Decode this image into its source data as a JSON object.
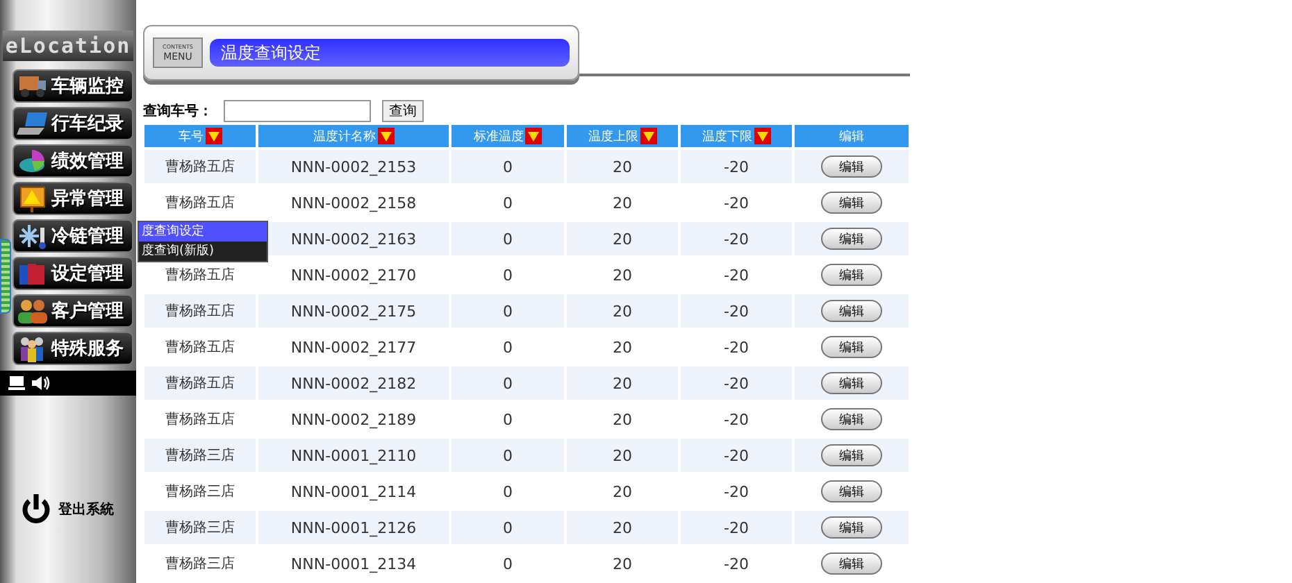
{
  "sidebar": {
    "logo": "eLocation",
    "items": [
      {
        "label": "车辆监控"
      },
      {
        "label": "行车纪录"
      },
      {
        "label": "绩效管理"
      },
      {
        "label": "异常管理"
      },
      {
        "label": "冷链管理"
      },
      {
        "label": "设定管理"
      },
      {
        "label": "客户管理"
      },
      {
        "label": "特殊服务"
      }
    ],
    "logout": "登出系統"
  },
  "popup_menu": [
    {
      "label": "度查询设定",
      "selected": true
    },
    {
      "label": "度查询(新版)",
      "selected": false
    }
  ],
  "banner": {
    "badge_top": "CONTENTS",
    "badge_bottom": "MENU",
    "title": "温度查询设定"
  },
  "search": {
    "label": "查询车号：",
    "button": "查询"
  },
  "table": {
    "columns": [
      {
        "label": "车号",
        "sortable": true
      },
      {
        "label": "温度计名称",
        "sortable": true
      },
      {
        "label": "标准温度",
        "sortable": true
      },
      {
        "label": "温度上限",
        "sortable": true
      },
      {
        "label": "温度下限",
        "sortable": true
      },
      {
        "label": "编辑",
        "sortable": false
      }
    ],
    "rows": [
      {
        "store": "曹杨路五店",
        "sensor": "NNN-0002_2153",
        "standard": "0",
        "upper": "20",
        "lower": "-20",
        "action": "编辑"
      },
      {
        "store": "曹杨路五店",
        "sensor": "NNN-0002_2158",
        "standard": "0",
        "upper": "20",
        "lower": "-20",
        "action": "编辑"
      },
      {
        "sensor": "NNN-0002_2163",
        "standard": "0",
        "upper": "20",
        "lower": "-20",
        "action": "编辑"
      },
      {
        "store": "曹杨路五店",
        "sensor": "NNN-0002_2170",
        "standard": "0",
        "upper": "20",
        "lower": "-20",
        "action": "编辑"
      },
      {
        "store": "曹杨路五店",
        "sensor": "NNN-0002_2175",
        "standard": "0",
        "upper": "20",
        "lower": "-20",
        "action": "编辑"
      },
      {
        "store": "曹杨路五店",
        "sensor": "NNN-0002_2177",
        "standard": "0",
        "upper": "20",
        "lower": "-20",
        "action": "编辑"
      },
      {
        "store": "曹杨路五店",
        "sensor": "NNN-0002_2182",
        "standard": "0",
        "upper": "20",
        "lower": "-20",
        "action": "编辑"
      },
      {
        "store": "曹杨路五店",
        "sensor": "NNN-0002_2189",
        "standard": "0",
        "upper": "20",
        "lower": "-20",
        "action": "编辑"
      },
      {
        "store": "曹杨路三店",
        "sensor": "NNN-0001_2110",
        "standard": "0",
        "upper": "20",
        "lower": "-20",
        "action": "编辑"
      },
      {
        "store": "曹杨路三店",
        "sensor": "NNN-0001_2114",
        "standard": "0",
        "upper": "20",
        "lower": "-20",
        "action": "编辑"
      },
      {
        "store": "曹杨路三店",
        "sensor": "NNN-0001_2126",
        "standard": "0",
        "upper": "20",
        "lower": "-20",
        "action": "编辑"
      },
      {
        "store": "曹杨路三店",
        "sensor": "NNN-0001_2134",
        "standard": "0",
        "upper": "20",
        "lower": "-20",
        "action": "编辑"
      }
    ]
  }
}
